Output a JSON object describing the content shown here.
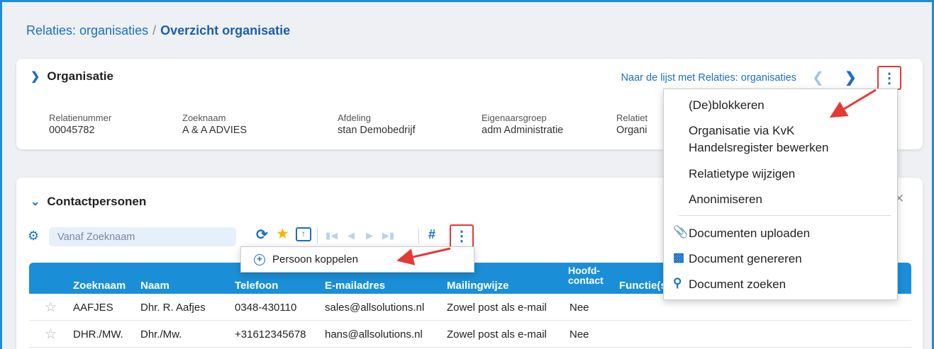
{
  "breadcrumb": {
    "parent": "Relaties: organisaties",
    "separator": "/",
    "current": "Overzicht organisatie"
  },
  "organisatie": {
    "title": "Organisatie",
    "nav_link": "Naar de lijst met Relaties: organisaties",
    "fields": [
      {
        "label": "Relatienummer",
        "value": "00045782"
      },
      {
        "label": "Zoeknaam",
        "value": "A & A ADVIES"
      },
      {
        "label": "Afdeling",
        "value": "stan Demobedrijf"
      },
      {
        "label": "Eigenaarsgroep",
        "value": "adm Administratie"
      },
      {
        "label": "Relatiet",
        "value": "Organi"
      }
    ]
  },
  "contactpersonen": {
    "title": "Contactpersonen",
    "search_placeholder": "Vanaf Zoeknaam",
    "hash_label": "#",
    "columns": [
      "Zoeknaam",
      "Naam",
      "Telefoon",
      "E-mailadres",
      "Mailingwijze",
      "Hoofd-",
      "contact",
      "Functie(s"
    ],
    "rows": [
      {
        "zoeknaam": "AAFJES",
        "naam": "Dhr. R. Aafjes",
        "telefoon": "0348-430110",
        "email": "sales@allsolutions.nl",
        "mailingwijze": "Zowel post als e-mail",
        "hoofdcontact": "Nee"
      },
      {
        "zoeknaam": "DHR./MW.",
        "naam": "Dhr./Mw.",
        "telefoon": "+31612345678",
        "email": "hans@allsolutions.nl",
        "mailingwijze": "Zowel post als e-mail",
        "hoofdcontact": "Nee"
      }
    ]
  },
  "sub_menu": {
    "item": "Persoon koppelen"
  },
  "main_menu": {
    "items": [
      "(De)blokkeren",
      "Organisatie via KvK",
      "Handelsregister bewerken",
      "Relatietype wijzigen",
      "Anonimiseren",
      "Documenten uploaden",
      "Document genereren",
      "Document zoeken"
    ]
  },
  "colors": {
    "accent": "#1a8fd8",
    "link": "#1a6fc4",
    "highlight": "#e53935",
    "star": "#f6b400"
  }
}
